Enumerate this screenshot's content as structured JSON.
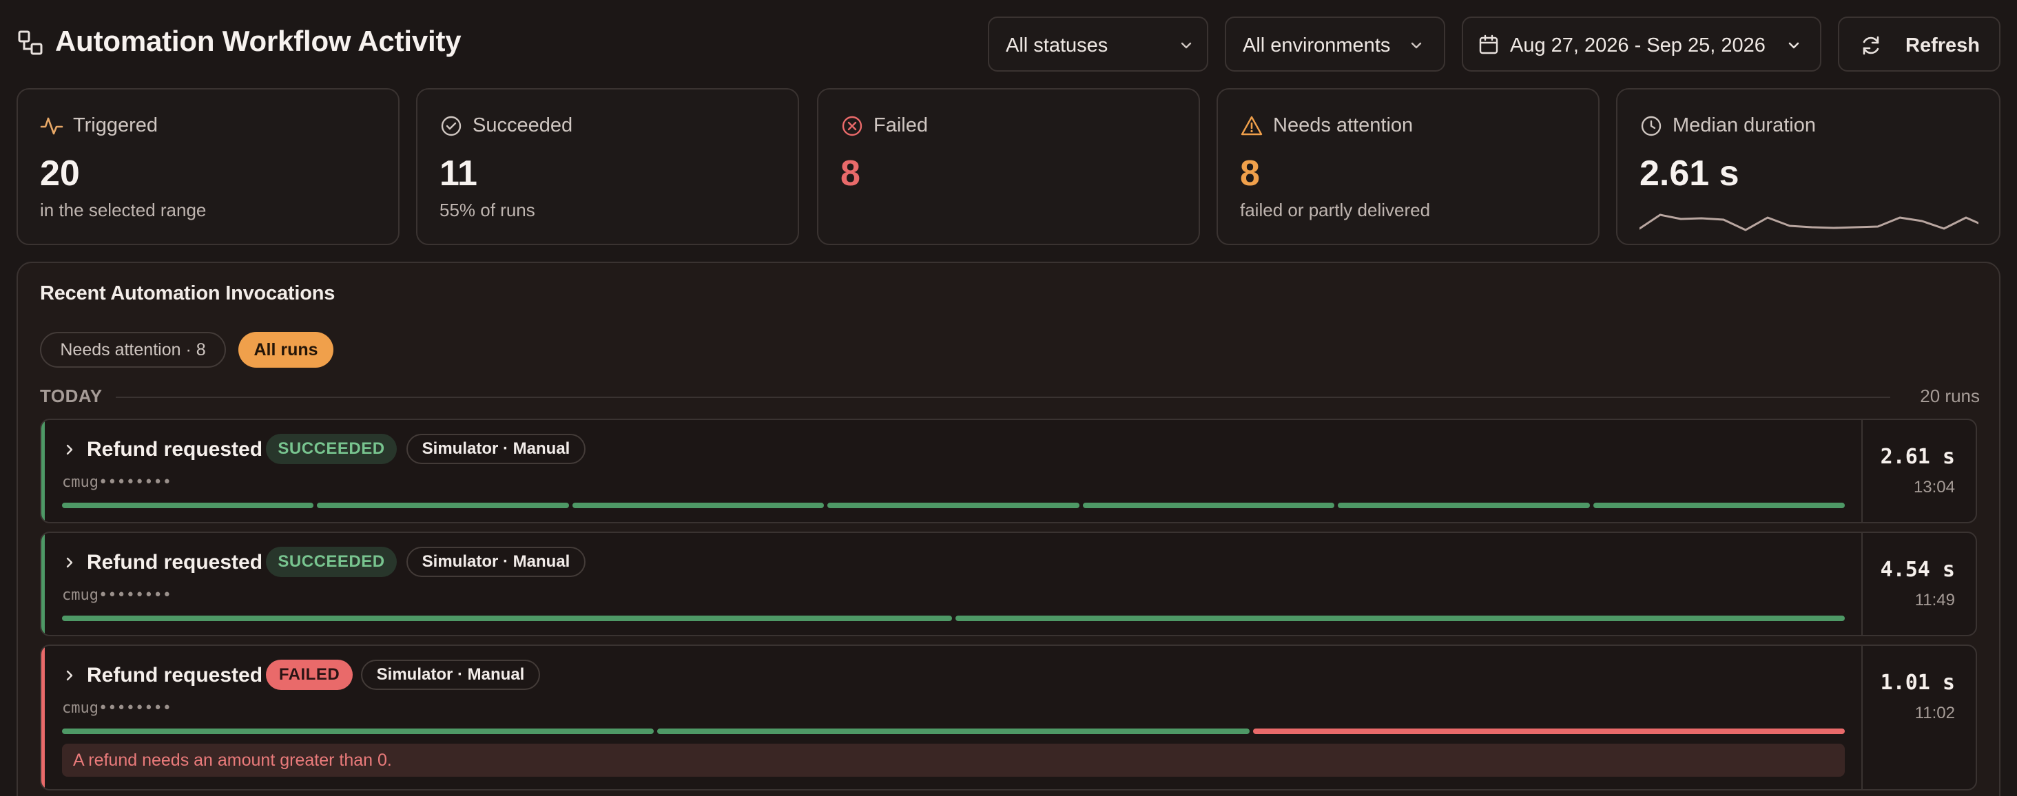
{
  "header": {
    "title": "Automation Workflow Activity",
    "status_filter": "All statuses",
    "environment_filter": "All environments",
    "date_range": "Aug 27, 2026 - Sep 25, 2026",
    "refresh_label": "Refresh"
  },
  "stats": {
    "triggered": {
      "label": "Triggered",
      "value": "20",
      "sub": "in the selected range"
    },
    "succeeded": {
      "label": "Succeeded",
      "value": "11",
      "sub": "55% of runs"
    },
    "failed": {
      "label": "Failed",
      "value": "8"
    },
    "attention": {
      "label": "Needs attention",
      "value": "8",
      "sub": "failed or partly delivered"
    },
    "median": {
      "label": "Median duration",
      "value": "2.61 s"
    }
  },
  "colors": {
    "accent": "#f0a04b",
    "success": "#4e9966",
    "failure": "#e96a6a",
    "warning": "#f0a04b"
  },
  "panel": {
    "title": "Recent Automation Invocations",
    "chips": {
      "attention": "Needs attention · 8",
      "all": "All runs"
    },
    "section": {
      "label": "TODAY",
      "count": "20 runs"
    },
    "runs": [
      {
        "title": "Refund requested",
        "status": "SUCCEEDED",
        "source": "Simulator · Manual",
        "id": "cmug••••••••",
        "duration": "2.61 s",
        "time": "13:04",
        "steps": [
          "ok",
          "ok",
          "ok",
          "ok",
          "ok",
          "ok",
          "ok"
        ]
      },
      {
        "title": "Refund requested",
        "status": "SUCCEEDED",
        "source": "Simulator · Manual",
        "id": "cmug••••••••",
        "duration": "4.54 s",
        "time": "11:49",
        "steps": [
          "ok",
          "ok"
        ]
      },
      {
        "title": "Refund requested",
        "status": "FAILED",
        "source": "Simulator · Manual",
        "id": "cmug••••••••",
        "duration": "1.01 s",
        "time": "11:02",
        "steps": [
          "ok",
          "ok",
          "fail"
        ],
        "error": "A refund needs an amount greater than 0."
      }
    ]
  },
  "icons": {
    "app": "workflow-icon",
    "date": "calendar-icon",
    "refresh": "refresh-icon",
    "triggered": "activity-icon",
    "succeeded": "check-circle-icon",
    "failed": "x-circle-icon",
    "attention": "warning-triangle-icon",
    "median": "clock-icon"
  }
}
